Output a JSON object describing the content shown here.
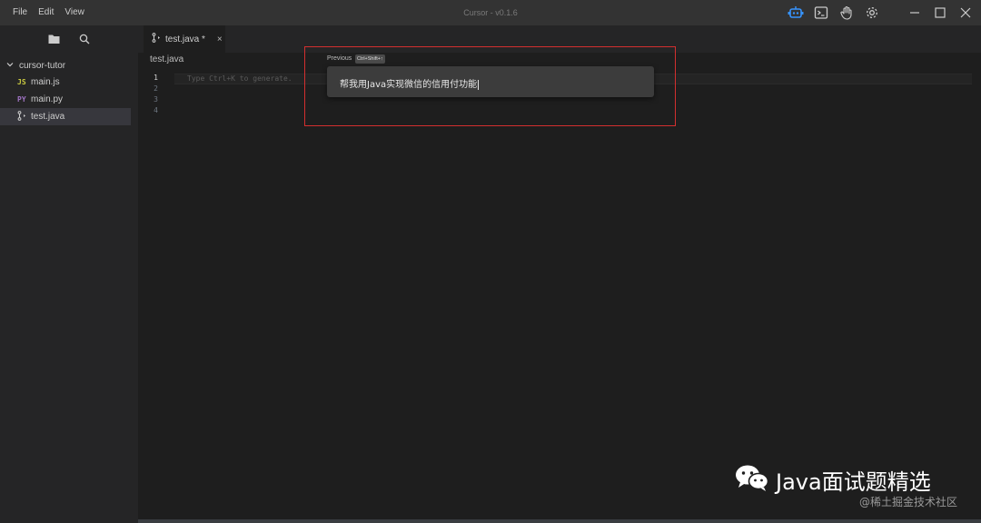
{
  "menu": {
    "items": [
      "File",
      "Edit",
      "View"
    ]
  },
  "window": {
    "title": "Cursor - v0.1.6"
  },
  "title_icons": [
    "robot-icon",
    "terminal-icon",
    "hand-icon",
    "gear-icon"
  ],
  "window_controls": [
    "minimize-icon",
    "maximize-icon",
    "close-icon"
  ],
  "sidebar": {
    "tabs": [
      "folder-icon",
      "search-icon"
    ],
    "root": {
      "label": "cursor-tutor",
      "expanded": true
    },
    "files": [
      {
        "type": "JS",
        "label": "main.js",
        "active": false
      },
      {
        "type": "PY",
        "label": "main.py",
        "active": false
      },
      {
        "type": "java-icon",
        "label": "test.java",
        "active": true
      }
    ]
  },
  "editor": {
    "tab": {
      "label": "test.java *",
      "close": "×"
    },
    "breadcrumb": "test.java",
    "line_numbers": [
      "1",
      "2",
      "3",
      "4"
    ],
    "hint": "Type Ctrl+K to generate."
  },
  "prompt": {
    "previous_label": "Previous",
    "shortcut": "Ctrl+Shift+↑",
    "text": "帮我用Java实现微信的信用付功能"
  },
  "watermark": {
    "title": "Java面试题精选",
    "sub": "@稀土掘金技术社区"
  },
  "colors": {
    "accent": "#3794ff",
    "highlight_border": "#d32f2f",
    "js": "#cbcb41",
    "py": "#a074c4"
  }
}
